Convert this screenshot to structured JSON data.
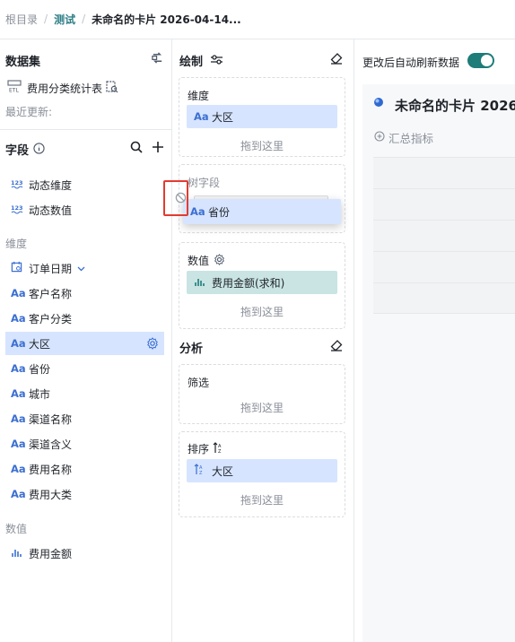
{
  "breadcrumb": {
    "root": "根目录",
    "sep": "/",
    "folder": "测试",
    "current": "未命名的卡片 2026-04-14..."
  },
  "dataset": {
    "title": "数据集",
    "table_name": "费用分类统计表",
    "last_update_label": "最近更新:"
  },
  "fields": {
    "title": "字段",
    "dynamic_dimension": "动态维度",
    "dynamic_value": "动态数值",
    "dimension_header": "维度",
    "dimensions": [
      "订单日期",
      "客户名称",
      "客户分类",
      "大区",
      "省份",
      "城市",
      "渠道名称",
      "渠道含义",
      "费用名称",
      "费用大类"
    ],
    "value_header": "数值",
    "values": [
      "费用金额"
    ],
    "type_glyph": "Aa"
  },
  "draw": {
    "title": "绘制",
    "dimension_label": "维度",
    "dimension_chip": "大区",
    "drop_hint": "拖到这里",
    "tree_field_label": "树字段",
    "dragging_chip": "省份",
    "value_label": "数值",
    "value_chip": "费用金额(求和)"
  },
  "analysis": {
    "title": "分析",
    "filter_label": "筛选",
    "sort_label": "排序",
    "sort_chip": "大区",
    "drop_hint": "拖到这里"
  },
  "preview": {
    "auto_refresh_label": "更改后自动刷新数据",
    "auto_refresh_on": true,
    "card_title": "未命名的卡片 2026",
    "add_metric_label": "汇总指标"
  },
  "colors": {
    "accent": "#1e7c79",
    "selected_bg": "#d6e4ff",
    "value_chip_bg": "#c9e4e3",
    "type_blue": "#3b6fd1",
    "error_red": "#e23b32"
  }
}
